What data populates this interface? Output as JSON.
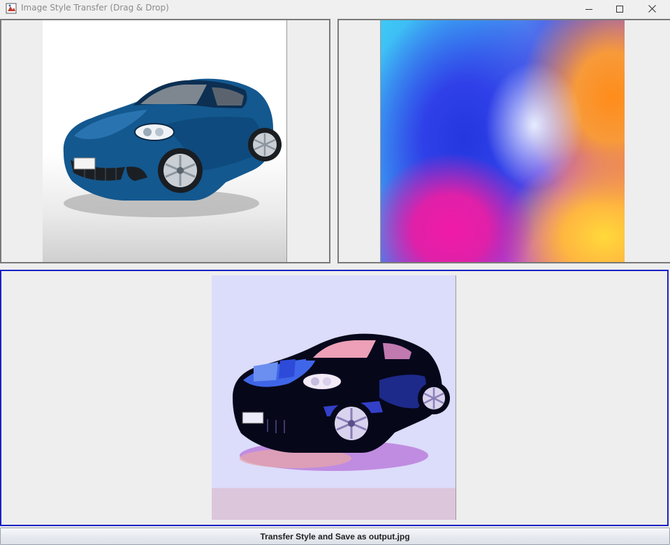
{
  "window": {
    "title": "Image Style Transfer (Drag & Drop)",
    "icons": {
      "app": "java-app-icon",
      "minimize": "minimize-icon",
      "maximize": "maximize-icon",
      "close": "close-icon"
    }
  },
  "panels": {
    "content": {
      "image": "blue-sports-car-photo"
    },
    "style": {
      "image": "colorful-gradient-abstract"
    },
    "result": {
      "image": "stylized-car-output",
      "border_color": "#1b22c6"
    }
  },
  "actions": {
    "transfer_label": "Transfer Style and Save as output.jpg"
  }
}
